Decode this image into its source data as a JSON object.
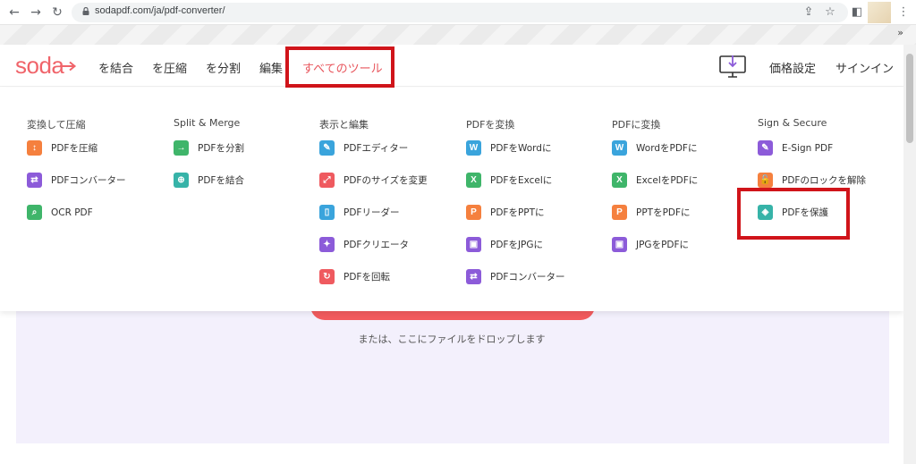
{
  "browser": {
    "url": "sodapdf.com/ja/pdf-converter/",
    "bookmarks_more": "»"
  },
  "site": {
    "logo": "soda",
    "nav": [
      "を結合",
      "を圧縮",
      "を分割",
      "編集",
      "すべてのツール"
    ],
    "right": [
      "価格設定",
      "サインイン"
    ],
    "accent_color": "#f0646a",
    "highlight_color": "#d0141a"
  },
  "menu": {
    "columns": [
      {
        "head": "変換して圧縮",
        "items": [
          {
            "label": "PDFを圧縮",
            "icon": "compress-icon",
            "color": "#f5803e",
            "glyph": "↕"
          },
          {
            "label": "PDFコンバーター",
            "icon": "converter-icon",
            "color": "#8c5bd9",
            "glyph": "⇄"
          },
          {
            "label": "OCR PDF",
            "icon": "ocr-icon",
            "color": "#3fb56a",
            "glyph": "⌕"
          }
        ]
      },
      {
        "head": "Split & Merge",
        "items": [
          {
            "label": "PDFを分割",
            "icon": "split-icon",
            "color": "#3fb56a",
            "glyph": "→"
          },
          {
            "label": "PDFを結合",
            "icon": "merge-icon",
            "color": "#36b3a8",
            "glyph": "⊕"
          }
        ]
      },
      {
        "head": "表示と編集",
        "items": [
          {
            "label": "PDFエディター",
            "icon": "editor-icon",
            "color": "#3aa4dc",
            "glyph": "✎"
          },
          {
            "label": "PDFのサイズを変更",
            "icon": "resize-icon",
            "color": "#ef5a5f",
            "glyph": "⤢"
          },
          {
            "label": "PDFリーダー",
            "icon": "reader-icon",
            "color": "#3aa4dc",
            "glyph": "▯"
          },
          {
            "label": "PDFクリエータ",
            "icon": "creator-icon",
            "color": "#8c5bd9",
            "glyph": "✦"
          },
          {
            "label": "PDFを回転",
            "icon": "rotate-icon",
            "color": "#ef5a5f",
            "glyph": "↻"
          }
        ]
      },
      {
        "head": "PDFを変換",
        "items": [
          {
            "label": "PDFをWordに",
            "icon": "word-icon",
            "color": "#3aa4dc",
            "glyph": "W"
          },
          {
            "label": "PDFをExcelに",
            "icon": "excel-icon",
            "color": "#3fb56a",
            "glyph": "X"
          },
          {
            "label": "PDFをPPTに",
            "icon": "ppt-icon",
            "color": "#f5803e",
            "glyph": "P"
          },
          {
            "label": "PDFをJPGに",
            "icon": "jpg-icon",
            "color": "#8c5bd9",
            "glyph": "▣"
          },
          {
            "label": "PDFコンバーター",
            "icon": "converter-icon",
            "color": "#8c5bd9",
            "glyph": "⇄"
          }
        ]
      },
      {
        "head": "PDFに変換",
        "items": [
          {
            "label": "WordをPDFに",
            "icon": "word-icon",
            "color": "#3aa4dc",
            "glyph": "W"
          },
          {
            "label": "ExcelをPDFに",
            "icon": "excel-icon",
            "color": "#3fb56a",
            "glyph": "X"
          },
          {
            "label": "PPTをPDFに",
            "icon": "ppt-icon",
            "color": "#f5803e",
            "glyph": "P"
          },
          {
            "label": "JPGをPDFに",
            "icon": "jpg-icon",
            "color": "#8c5bd9",
            "glyph": "▣"
          }
        ]
      },
      {
        "head": "Sign & Secure",
        "items": [
          {
            "label": "E-Sign PDF",
            "icon": "esign-icon",
            "color": "#8c5bd9",
            "glyph": "✎"
          },
          {
            "label": "PDFのロックを解除",
            "icon": "unlock-icon",
            "color": "#f5803e",
            "glyph": "🔓"
          },
          {
            "label": "PDFを保護",
            "icon": "protect-icon",
            "color": "#36b3a8",
            "glyph": "◈"
          }
        ]
      }
    ]
  },
  "page": {
    "drop_text": "または、ここにファイルをドロップします"
  }
}
